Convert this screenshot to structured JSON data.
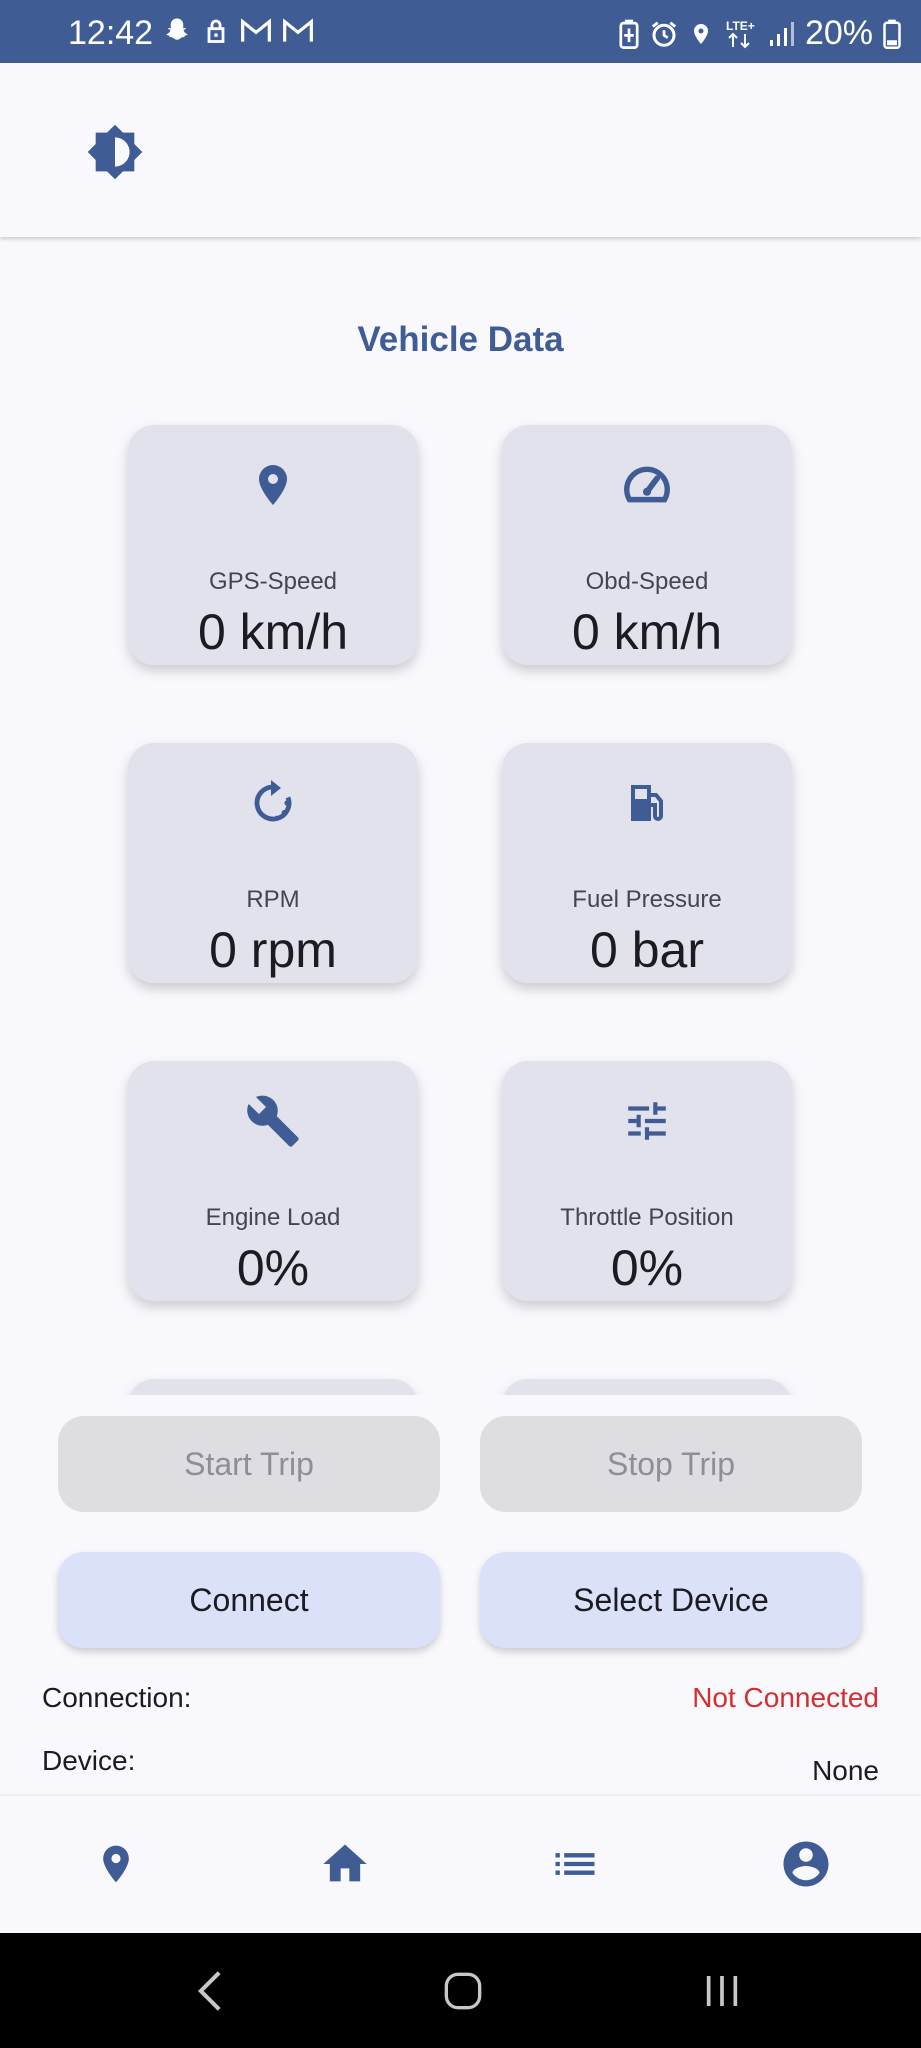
{
  "status_bar": {
    "time": "12:42",
    "battery": "20%",
    "left_icons": [
      "snapchat-icon",
      "lock-icon",
      "gmail-icon",
      "gmail-icon"
    ],
    "right_icons": [
      "battery-saver-icon",
      "alarm-icon",
      "location-icon",
      "lte-icon",
      "signal-icon",
      "battery-icon"
    ]
  },
  "top_bar": {
    "theme_icon": "brightness-icon"
  },
  "section": {
    "title": "Vehicle Data"
  },
  "cards": [
    {
      "icon": "location-pin-icon",
      "label": "GPS-Speed",
      "value": "0 km/h"
    },
    {
      "icon": "speedometer-icon",
      "label": "Obd-Speed",
      "value": "0 km/h"
    },
    {
      "icon": "rotate-icon",
      "label": "RPM",
      "value": "0 rpm"
    },
    {
      "icon": "fuel-pump-icon",
      "label": "Fuel Pressure",
      "value": "0 bar"
    },
    {
      "icon": "wrench-icon",
      "label": "Engine Load",
      "value": "0%"
    },
    {
      "icon": "sliders-icon",
      "label": "Throttle Position",
      "value": "0%"
    }
  ],
  "buttons": {
    "start_trip": "Start Trip",
    "stop_trip": "Stop Trip",
    "connect": "Connect",
    "select_device": "Select Device"
  },
  "info": {
    "connection_label": "Connection:",
    "connection_value": "Not Connected",
    "device_label": "Device:",
    "device_value": "None"
  },
  "bottom_nav": [
    "map-pin-icon",
    "home-icon",
    "list-icon",
    "account-icon"
  ],
  "colors": {
    "primary": "#3f5d94",
    "card_bg": "#e1e2ec",
    "error": "#d32f2f",
    "tonal_button": "#dbe1f9"
  }
}
